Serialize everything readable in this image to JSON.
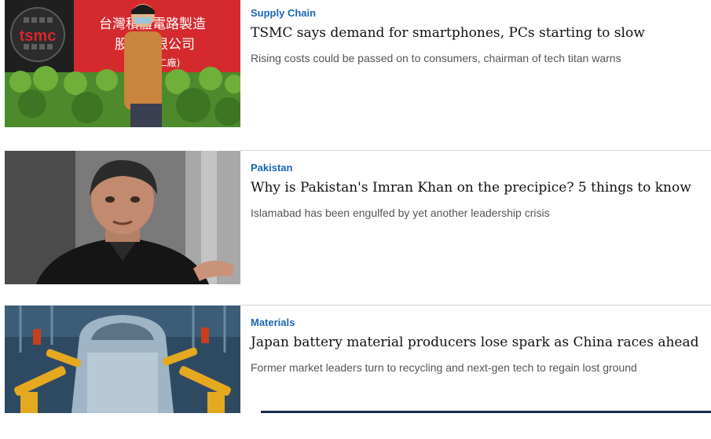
{
  "articles": [
    {
      "category": "Supply Chain",
      "headline": "TSMC says demand for smartphones, PCs starting to slow",
      "subhead": "Rising costs could be passed on to consumers, chairman of tech titan warns",
      "image": {
        "logo_text": "tsmc",
        "sign_line1": "台灣積體電路製造",
        "sign_line2": "股份有限公司",
        "sign_line3": "(二廠)"
      }
    },
    {
      "category": "Pakistan",
      "headline": "Why is Pakistan's Imran Khan on the precipice? 5 things to know",
      "subhead": "Islamabad has been engulfed by yet another leadership crisis"
    },
    {
      "category": "Materials",
      "headline": "Japan battery material producers lose spark as China races ahead",
      "subhead": "Former market leaders turn to recycling and next-gen tech to regain lost ground"
    }
  ],
  "colors": {
    "category": "#1a66b8",
    "headline": "#111111",
    "subhead": "#555555",
    "tsmc_red": "#d9262c"
  }
}
